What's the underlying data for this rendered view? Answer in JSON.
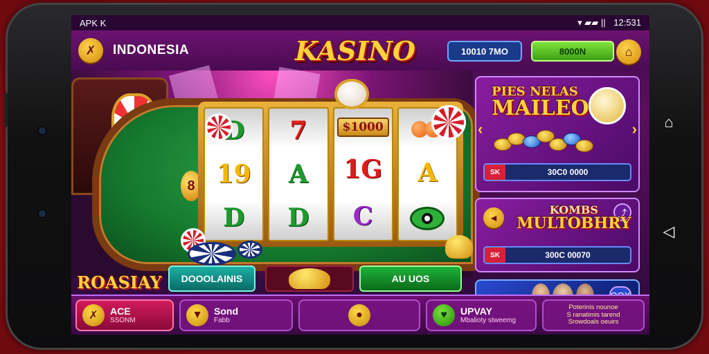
{
  "status_bar": {
    "carrier": "APK K",
    "time": "12:531",
    "signal": "▾ ▰▰ ||"
  },
  "header": {
    "back_icon": "back-arrow-icon",
    "region": "INDONESIA",
    "logo": "KASINO",
    "balance": "10010 7MO",
    "bonus": "8000N",
    "gift_icon": "gift-icon"
  },
  "reels": [
    [
      "D",
      "19",
      "D"
    ],
    [
      "7",
      "A",
      "D"
    ],
    [
      "$1000",
      "1G",
      "C"
    ],
    [
      "fruit",
      "A",
      "eye"
    ]
  ],
  "side_badge": "8",
  "promos": {
    "promo1": {
      "title_line1": "PIES  NELAS",
      "title_line2": "MAILEOS",
      "amount": "30C0 0000",
      "tag": "SK"
    },
    "promo2": {
      "title_line1": "KOMBS",
      "title_line2": "MULTOBHRY",
      "amount": "300C 00070",
      "tag": "SK"
    },
    "promo3": {
      "share": "OOX"
    }
  },
  "mid_row": {
    "left_logo": "ROASIAY",
    "download_label": "DOOOLAINIS",
    "ad_label": "AU UOS"
  },
  "bottom_nav": [
    {
      "title": "ACE",
      "sub": "SSONM",
      "icon": "sword-icon",
      "active": true
    },
    {
      "title": "Sond",
      "sub": "Fabb",
      "icon": "bag-icon",
      "active": false
    },
    {
      "title": "",
      "sub": "",
      "icon": "person-icon",
      "active": false
    },
    {
      "title": "UPVAY",
      "sub": "Mbalioty stweemg",
      "icon": "heart-icon",
      "active": false
    },
    {
      "title": "",
      "sub": "Poterinis nounoe\nS ranatimis tarend\nSrowdoals oeuirs",
      "icon": "",
      "active": false
    }
  ],
  "colors": {
    "accent": "#ffd23a",
    "brand": "#6b1370",
    "bonus_green": "#3ba114",
    "balance_blue": "#1a3a8a"
  }
}
